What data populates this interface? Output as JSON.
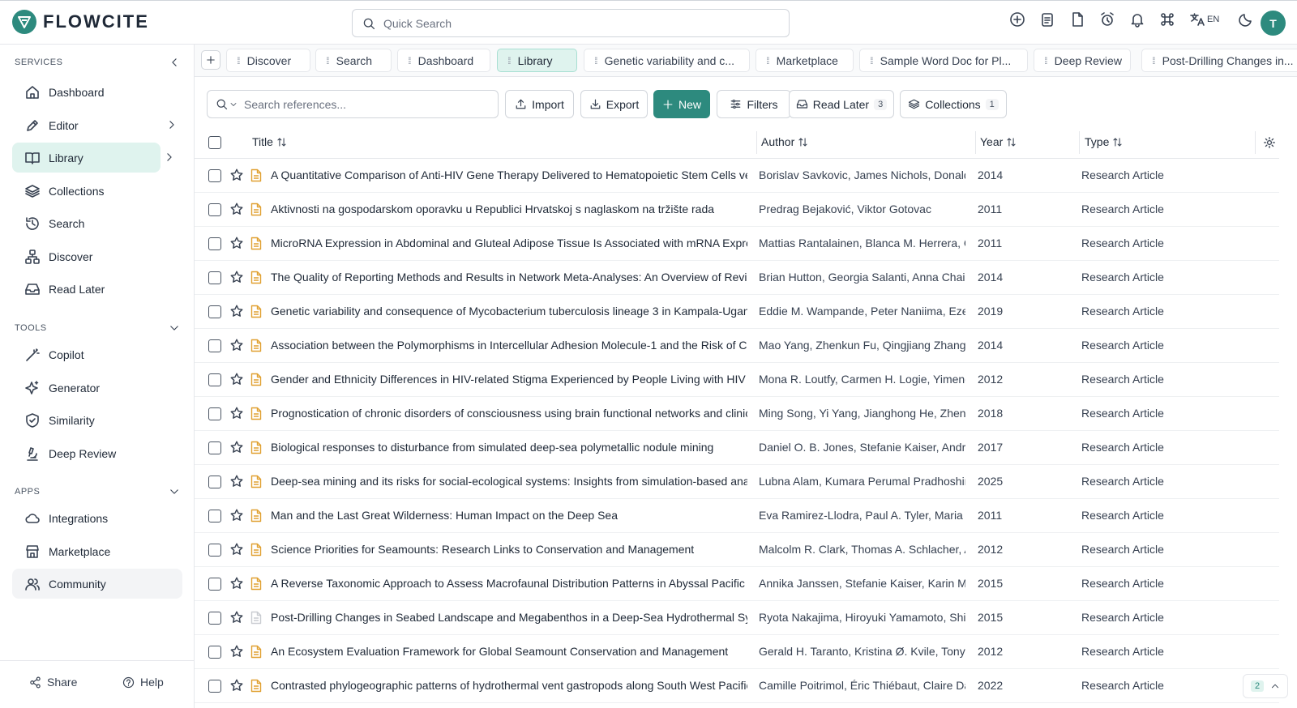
{
  "app": {
    "name": "FLOWCITE"
  },
  "header": {
    "search_placeholder": "Quick Search",
    "icons": [
      "plus-circle-icon",
      "clipboard-icon",
      "document-icon",
      "alarm-icon",
      "bell-icon",
      "command-icon",
      "translate-icon",
      "moon-icon"
    ],
    "lang": "EN",
    "avatar_initial": "T"
  },
  "sidebar": {
    "services_title": "SERVICES",
    "services": [
      {
        "label": "Dashboard",
        "icon": "home-icon"
      },
      {
        "label": "Editor",
        "icon": "pen-icon"
      },
      {
        "label": "Library",
        "icon": "book-icon"
      },
      {
        "label": "Collections",
        "icon": "layers-icon"
      },
      {
        "label": "Search",
        "icon": "history-icon"
      },
      {
        "label": "Discover",
        "icon": "network-icon"
      },
      {
        "label": "Read Later",
        "icon": "inbox-icon"
      }
    ],
    "tools_title": "TOOLS",
    "tools": [
      {
        "label": "Copilot",
        "icon": "wand-icon"
      },
      {
        "label": "Generator",
        "icon": "sparkles-icon"
      },
      {
        "label": "Similarity",
        "icon": "shield-check-icon"
      },
      {
        "label": "Deep Review",
        "icon": "microscope-icon"
      }
    ],
    "apps_title": "APPS",
    "apps": [
      {
        "label": "Integrations",
        "icon": "cloud-icon"
      },
      {
        "label": "Marketplace",
        "icon": "store-icon"
      },
      {
        "label": "Community",
        "icon": "users-icon"
      }
    ],
    "share_label": "Share",
    "help_label": "Help"
  },
  "tabs": [
    "Discover",
    "Search",
    "Dashboard",
    "Library",
    "Genetic variability and c...",
    "Marketplace",
    "Sample Word Doc for Pl...",
    "Deep Review",
    "Post-Drilling Changes in..."
  ],
  "toolbar": {
    "search_placeholder": "Search references...",
    "import": "Import",
    "export": "Export",
    "new": "New",
    "filters": "Filters",
    "read_later": "Read Later",
    "read_later_count": "3",
    "collections": "Collections",
    "collections_count": "1"
  },
  "table": {
    "columns": {
      "title": "Title",
      "author": "Author",
      "year": "Year",
      "type": "Type"
    },
    "rows": [
      {
        "title": "A Quantitative Comparison of Anti-HIV Gene Therapy Delivered to Hematopoietic Stem Cells versus...",
        "author": "Borislav Savkovic, James Nichols, Donald ...",
        "year": "2014",
        "type": "Research Article",
        "has_pdf": true
      },
      {
        "title": "Aktivnosti na gospodarskom oporavku u Republici Hrvatskoj s naglaskom na tržište rada",
        "author": "Predrag Bejaković, Viktor Gotovac",
        "year": "2011",
        "type": "Research Article",
        "has_pdf": true
      },
      {
        "title": "MicroRNA Expression in Abdominal and Gluteal Adipose Tissue Is Associated with mRNA Expressio...",
        "author": "Mattias Rantalainen, Blanca M. Herrera, G...",
        "year": "2011",
        "type": "Research Article",
        "has_pdf": true
      },
      {
        "title": "The Quality of Reporting Methods and Results in Network Meta-Analyses: An Overview of Reviews ...",
        "author": "Brian Hutton, Georgia Salanti, Anna Chaim...",
        "year": "2014",
        "type": "Research Article",
        "has_pdf": true
      },
      {
        "title": "Genetic variability and consequence of Mycobacterium tuberculosis lineage 3 in Kampala-Uganda",
        "author": "Eddie M. Wampande, Peter Naniima, Ezeki...",
        "year": "2019",
        "type": "Research Article",
        "has_pdf": true
      },
      {
        "title": "Association between the Polymorphisms in Intercellular Adhesion Molecule-1 and the Risk of Coron...",
        "author": "Mao Yang, Zhenkun Fu, Qingjiang Zhang, ...",
        "year": "2014",
        "type": "Research Article",
        "has_pdf": true
      },
      {
        "title": "Gender and Ethnicity Differences in HIV-related Stigma Experienced by People Living with HIV in On...",
        "author": "Mona R. Loutfy, Carmen H. Logie, Yimeng ...",
        "year": "2012",
        "type": "Research Article",
        "has_pdf": true
      },
      {
        "title": "Prognostication of chronic disorders of consciousness using brain functional networks and clinical c...",
        "author": "Ming Song, Yi Yang, Jianghong He, Zheng...",
        "year": "2018",
        "type": "Research Article",
        "has_pdf": true
      },
      {
        "title": "Biological responses to disturbance from simulated deep-sea polymetallic nodule mining",
        "author": "Daniel O. B. Jones, Stefanie Kaiser, Andrew...",
        "year": "2017",
        "type": "Research Article",
        "has_pdf": true
      },
      {
        "title": "Deep-sea mining and its risks for social-ecological systems: Insights from simulation-based analyses",
        "author": "Lubna Alam, Kumara Perumal Pradhoshini,...",
        "year": "2025",
        "type": "Research Article",
        "has_pdf": true
      },
      {
        "title": "Man and the Last Great Wilderness: Human Impact on the Deep Sea",
        "author": "Eva Ramirez-Llodra, Paul A. Tyler, Maria C. ...",
        "year": "2011",
        "type": "Research Article",
        "has_pdf": true
      },
      {
        "title": "Science Priorities for Seamounts: Research Links to Conservation and Management",
        "author": "Malcolm R. Clark, Thomas A. Schlacher, As...",
        "year": "2012",
        "type": "Research Article",
        "has_pdf": true
      },
      {
        "title": "A Reverse Taxonomic Approach to Assess Macrofaunal Distribution Patterns in Abyssal Pacific Poly...",
        "author": "Annika Janssen, Stefanie Kaiser, Karin Mei...",
        "year": "2015",
        "type": "Research Article",
        "has_pdf": true
      },
      {
        "title": "Post-Drilling Changes in Seabed Landscape and Megabenthos in a Deep-Sea Hydrothermal System,...",
        "author": "Ryota Nakajima, Hiroyuki Yamamoto, Shin...",
        "year": "2015",
        "type": "Research Article",
        "has_pdf": false
      },
      {
        "title": "An Ecosystem Evaluation Framework for Global Seamount Conservation and Management",
        "author": "Gerald H. Taranto, Kristina Ø. Kvile, Tony J. ...",
        "year": "2012",
        "type": "Research Article",
        "has_pdf": true
      },
      {
        "title": "Contrasted phylogeographic patterns of hydrothermal vent gastropods along South West Pacific: W...",
        "author": "Camille Poitrimol, Éric Thiébaut, Claire Da...",
        "year": "2022",
        "type": "Research Article",
        "has_pdf": true
      }
    ]
  },
  "pagination": {
    "current": "2"
  },
  "colors": {
    "brand": "#2d8a7e",
    "active_bg": "#dff3ee",
    "pdf_icon": "#e0a030"
  }
}
